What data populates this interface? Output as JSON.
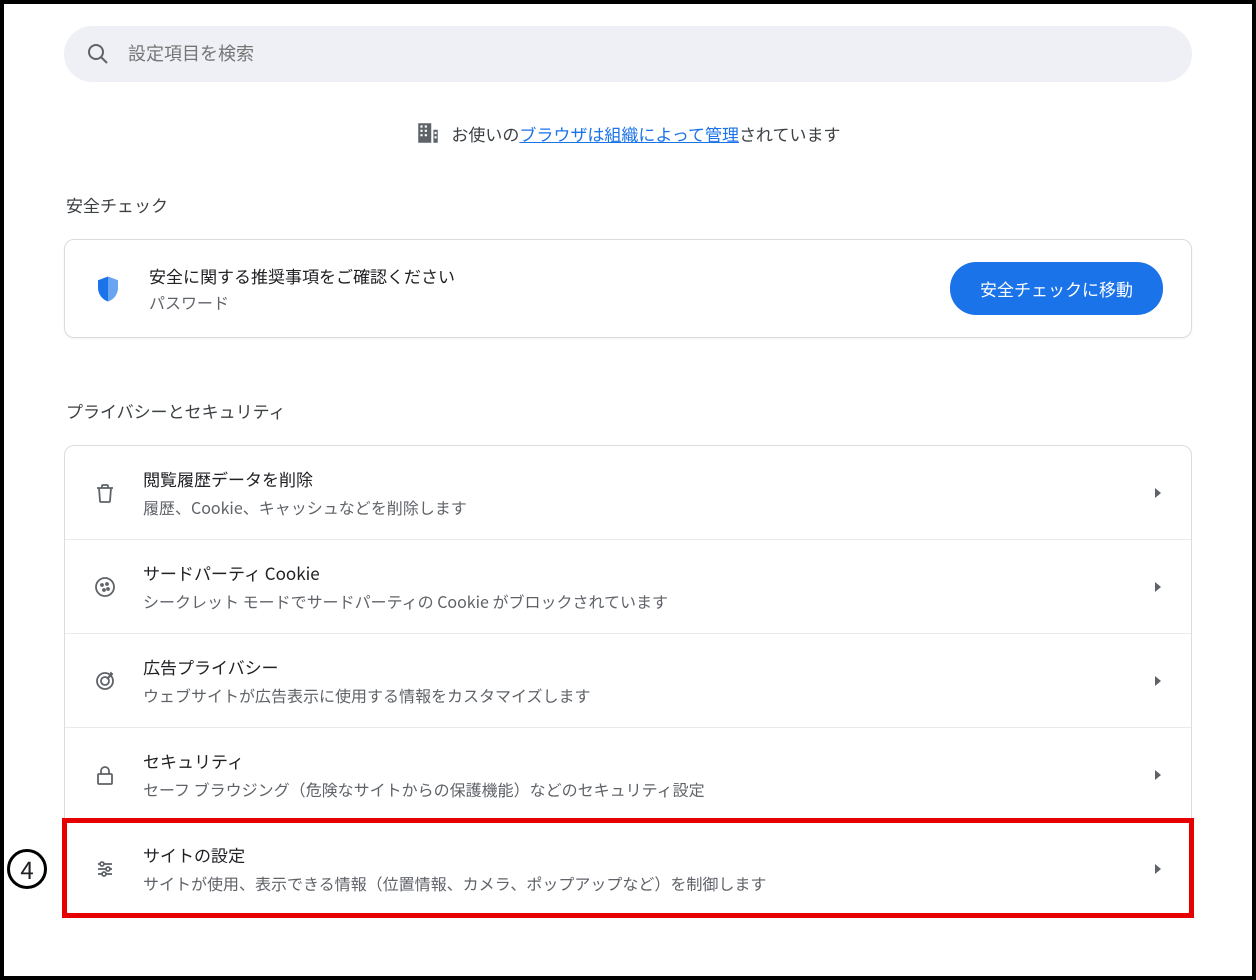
{
  "search": {
    "placeholder": "設定項目を検索"
  },
  "managed": {
    "prefix": "お使いの",
    "link": "ブラウザは組織によって管理",
    "suffix": "されています"
  },
  "safety": {
    "heading": "安全チェック",
    "title": "安全に関する推奨事項をご確認ください",
    "subtitle": "パスワード",
    "button": "安全チェックに移動"
  },
  "privacy": {
    "heading": "プライバシーとセキュリティ",
    "items": [
      {
        "title": "閲覧履歴データを削除",
        "subtitle": "履歴、Cookie、キャッシュなどを削除します"
      },
      {
        "title": "サードパーティ Cookie",
        "subtitle": "シークレット モードでサードパーティの Cookie がブロックされています"
      },
      {
        "title": "広告プライバシー",
        "subtitle": "ウェブサイトが広告表示に使用する情報をカスタマイズします"
      },
      {
        "title": "セキュリティ",
        "subtitle": "セーフ ブラウジング（危険なサイトからの保護機能）などのセキュリティ設定"
      },
      {
        "title": "サイトの設定",
        "subtitle": "サイトが使用、表示できる情報（位置情報、カメラ、ポップアップなど）を制御します"
      }
    ]
  },
  "annotation": {
    "step_number": "4"
  }
}
